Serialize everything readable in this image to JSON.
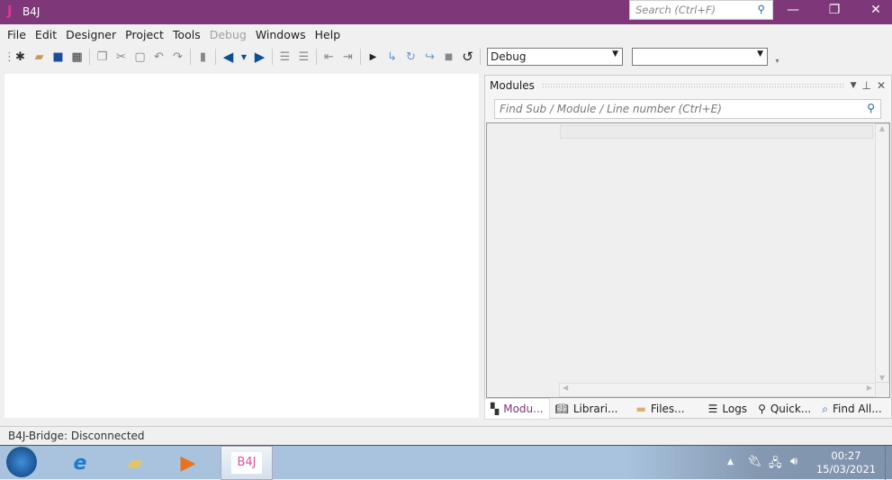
{
  "window": {
    "logo": "J",
    "title": "B4J",
    "search_placeholder": "Search (Ctrl+F)",
    "minimize": "—",
    "restore": "❐",
    "close": "✕"
  },
  "menu": [
    "File",
    "Edit",
    "Designer",
    "Project",
    "Tools",
    "Debug",
    "Windows",
    "Help"
  ],
  "toolbar": {
    "config_select": "Debug",
    "second_select": ""
  },
  "modules_panel": {
    "title": "Modules",
    "find_placeholder": "Find Sub / Module / Line number (Ctrl+E)"
  },
  "tabs": [
    "Modu...",
    "Librari...",
    "Files...",
    "Logs",
    "Quick...",
    "Find All..."
  ],
  "status": "B4J-Bridge: Disconnected",
  "taskbar": {
    "app_label": "B4J",
    "time": "00:27",
    "date": "15/03/2021"
  }
}
